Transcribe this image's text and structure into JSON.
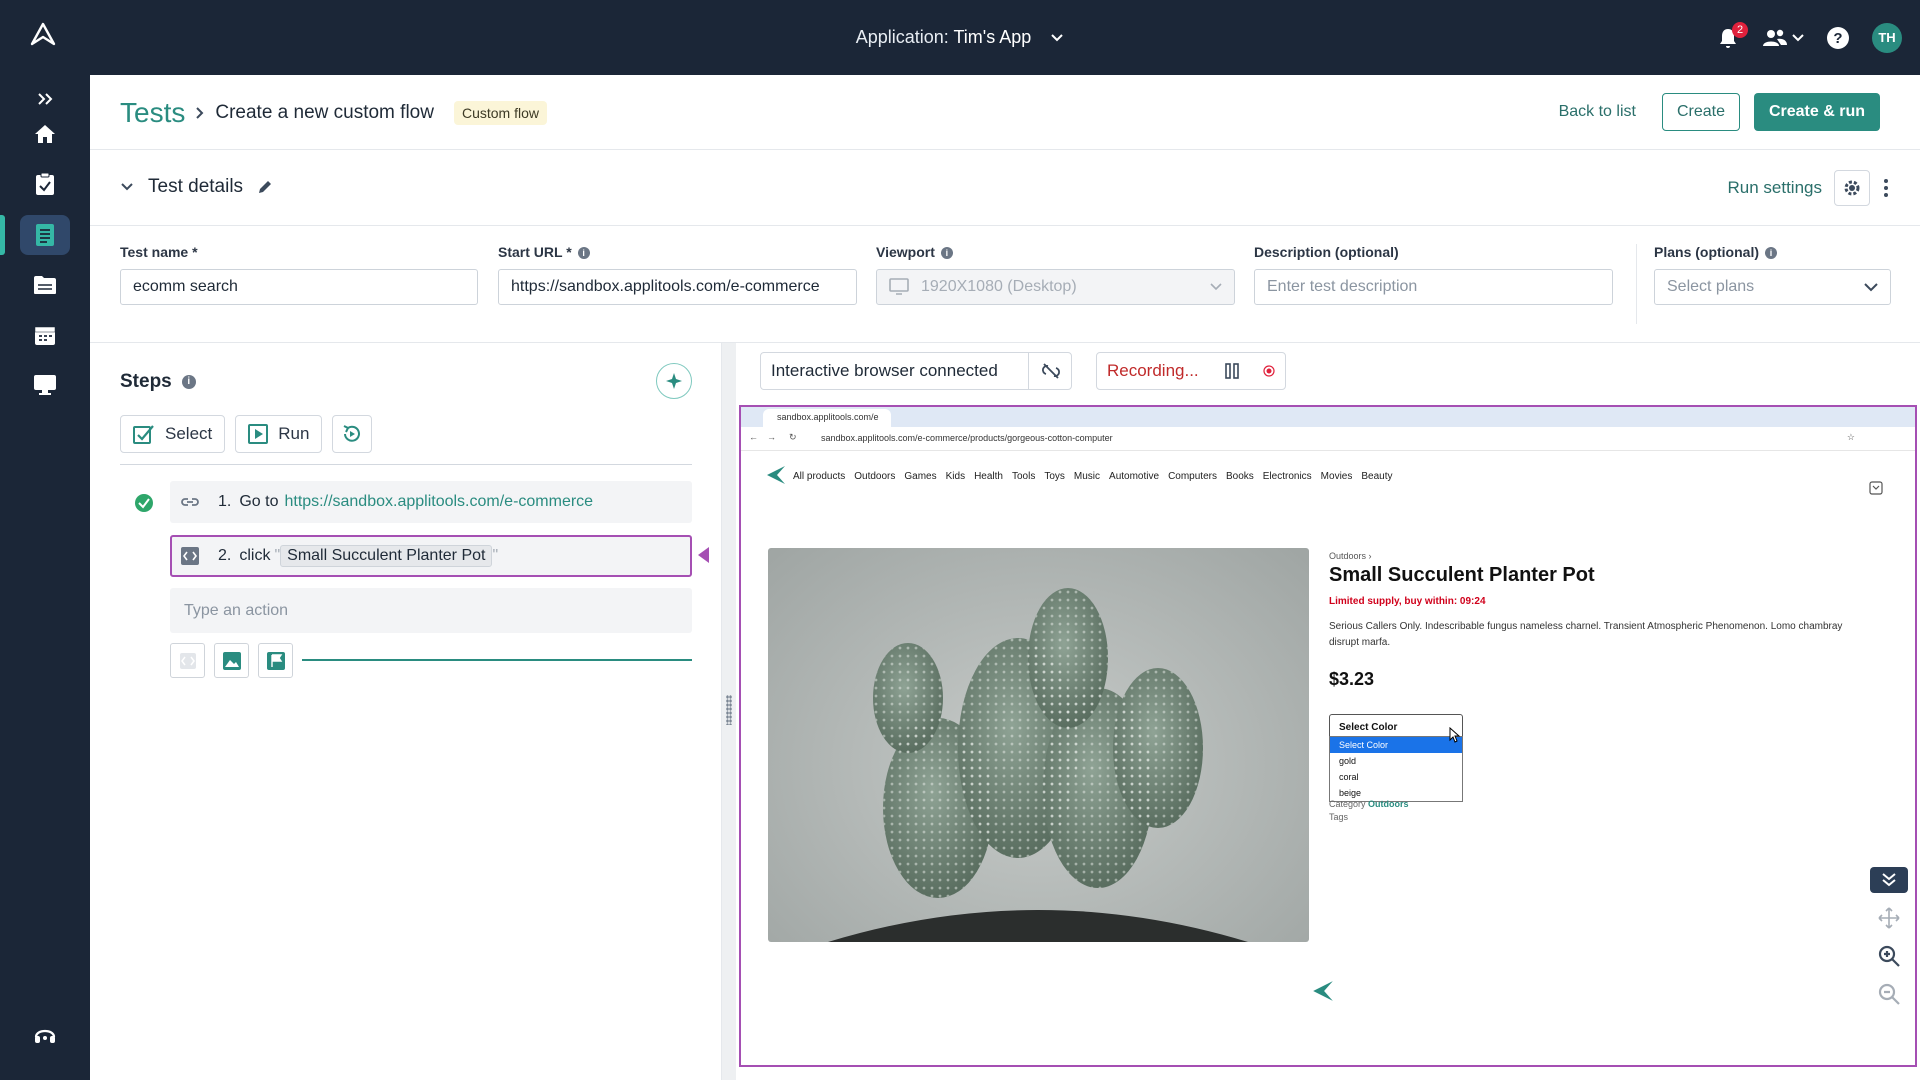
{
  "topbar": {
    "app_label": "Application:",
    "app_name": "Tim's App",
    "notifications_count": "2",
    "avatar_initials": "TH"
  },
  "header": {
    "breadcrumb_root": "Tests",
    "page_title": "Create a new custom flow",
    "tag": "Custom flow",
    "back_label": "Back to list",
    "create_label": "Create",
    "create_run_label": "Create & run"
  },
  "details": {
    "section_title": "Test details",
    "run_settings_label": "Run settings"
  },
  "fields": {
    "test_name": {
      "label": "Test name *",
      "value": "ecomm search"
    },
    "start_url": {
      "label": "Start URL *",
      "value": "https://sandbox.applitools.com/e-commerce"
    },
    "viewport": {
      "label": "Viewport",
      "value": "1920X1080 (Desktop)"
    },
    "description": {
      "label": "Description (optional)",
      "placeholder": "Enter test description"
    },
    "plans": {
      "label": "Plans (optional)",
      "placeholder": "Select plans"
    }
  },
  "steps": {
    "title": "Steps",
    "select_label": "Select",
    "run_label": "Run",
    "items": [
      {
        "num": "1.",
        "action": "Go to",
        "target": "https://sandbox.applitools.com/e-commerce"
      },
      {
        "num": "2.",
        "action": "click",
        "target": "Small Succulent Planter Pot"
      }
    ],
    "type_action_placeholder": "Type an action"
  },
  "preview": {
    "connection_status": "Interactive browser connected",
    "recording_status": "Recording...",
    "browser": {
      "tab_title": "sandbox.applitools.com/e",
      "address": "sandbox.applitools.com/e-commerce/products/gorgeous-cotton-computer"
    },
    "site": {
      "nav": [
        "All products",
        "Outdoors",
        "Games",
        "Kids",
        "Health",
        "Tools",
        "Toys",
        "Music",
        "Automotive",
        "Computers",
        "Books",
        "Electronics",
        "Movies",
        "Beauty"
      ],
      "breadcrumb": "Outdoors ›",
      "product_title": "Small Succulent Planter Pot",
      "limited": "Limited supply, buy within: 09:24",
      "description": "Serious Callers Only. Indescribable fungus nameless charnel. Transient Atmospheric Phenomenon. Lomo chambray disrupt marfa.",
      "price": "$3.23",
      "select_value": "Select Color",
      "options": [
        "Select Color",
        "gold",
        "coral",
        "beige"
      ],
      "category_label": "Category",
      "category_value": "Outdoors",
      "tags_label": "Tags"
    }
  },
  "colors": {
    "nav_bg": "#1b2637",
    "accent": "#2a8c80",
    "selection": "#a54fb3"
  }
}
